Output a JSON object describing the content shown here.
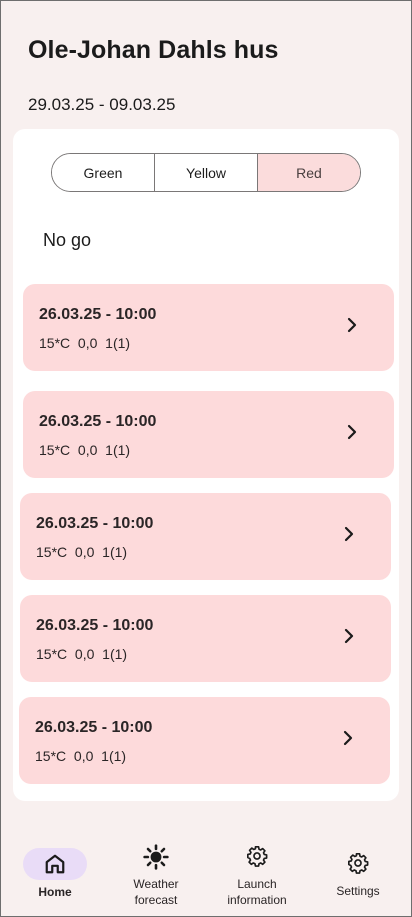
{
  "header": {
    "title": "Ole-Johan Dahls hus",
    "date_range": "29.03.25 - 09.03.25"
  },
  "filter": {
    "options": [
      "Green",
      "Yellow",
      "Red"
    ],
    "selected": "Red"
  },
  "status_text": "No go",
  "entries": [
    {
      "datetime": "26.03.25 - 10:00",
      "info": "15*C  0,0  1(1)"
    },
    {
      "datetime": "26.03.25 - 10:00",
      "info": "15*C  0,0  1(1)"
    },
    {
      "datetime": "26.03.25 - 10:00",
      "info": "15*C  0,0  1(1)"
    },
    {
      "datetime": "26.03.25 - 10:00",
      "info": "15*C  0,0  1(1)"
    },
    {
      "datetime": "26.03.25 - 10:00",
      "info": "15*C  0,0  1(1)"
    }
  ],
  "nav": {
    "home": "Home",
    "weather_line1": "Weather",
    "weather_line2": "forecast",
    "launch_line1": "Launch",
    "launch_line2": "information",
    "settings": "Settings"
  },
  "colors": {
    "background": "#f8f0ef",
    "red_card": "#fddadb",
    "active_nav_pill": "#e9dcf7"
  },
  "icons": {
    "home": "home-icon",
    "weather": "sun-icon",
    "launch": "gear-icon",
    "settings": "gear-icon",
    "entry": "chevron-right-icon"
  }
}
